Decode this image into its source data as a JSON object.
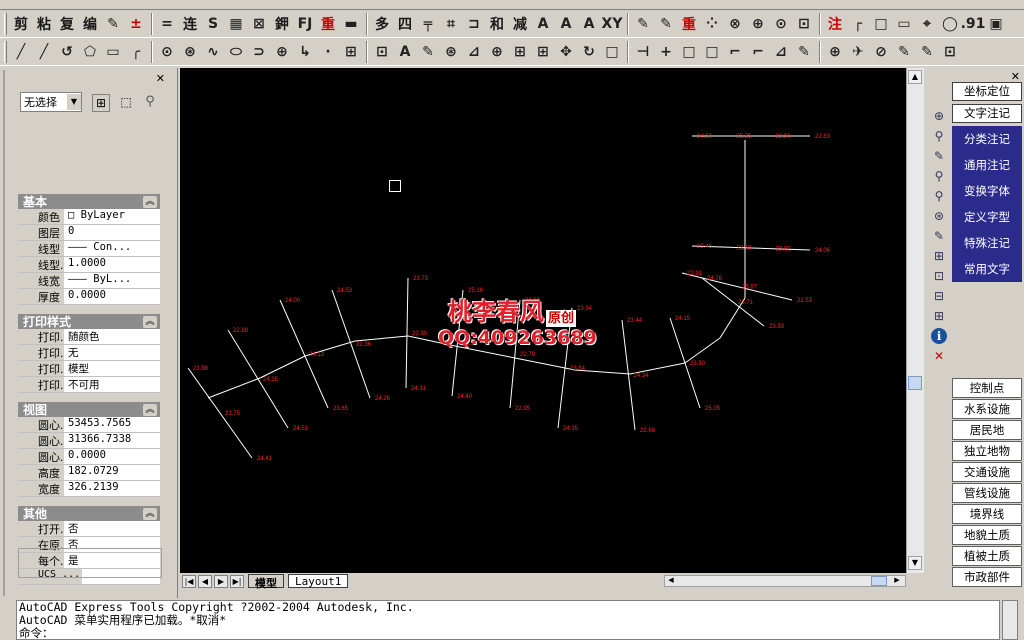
{
  "toolbar1": [
    "剪",
    "粘",
    "复",
    "编",
    "✎",
    "±",
    "=",
    "连",
    "S",
    "▦",
    "⊠",
    "鉀",
    "FJ",
    "重",
    "▬",
    "多",
    "四",
    "╤",
    "⌗",
    "⊐",
    "和",
    "减",
    "A",
    "A",
    "A",
    "XY",
    "✎",
    "✎",
    "重",
    "⁘",
    "⊗",
    "⊕",
    "⊙",
    "⊡",
    "注",
    "┌",
    "□",
    "▭",
    "⌖",
    "◯",
    ".91",
    "▣"
  ],
  "toolbar2": [
    "╱",
    "╱",
    "↺",
    "⬠",
    "▭",
    "╭",
    "⊙",
    "⊛",
    "∿",
    "⬭",
    "⊃",
    "⊕",
    "↳",
    "·",
    "⊞",
    "⊡",
    "A",
    "✎",
    "⊛",
    "⊿",
    "⊕",
    "⊞",
    "⊞",
    "✥",
    "↻",
    "□",
    "⊣",
    "+",
    "□",
    "□",
    "⌐",
    "⌐",
    "⊿",
    "✎",
    "⊕",
    "✈",
    "⊘",
    "✎",
    "✎",
    "⊡"
  ],
  "properties": {
    "select_value": "无选择",
    "sections": [
      {
        "title": "基本",
        "rows": [
          {
            "k": "颜色",
            "v": "□ ByLayer"
          },
          {
            "k": "图层",
            "v": "0"
          },
          {
            "k": "线型",
            "v": "——— Con..."
          },
          {
            "k": "线型...",
            "v": "1.0000"
          },
          {
            "k": "线宽",
            "v": "——— ByL..."
          },
          {
            "k": "厚度",
            "v": "0.0000"
          }
        ]
      },
      {
        "title": "打印样式",
        "rows": [
          {
            "k": "打印...",
            "v": "随颜色"
          },
          {
            "k": "打印...",
            "v": "无"
          },
          {
            "k": "打印...",
            "v": "模型"
          },
          {
            "k": "打印...",
            "v": "不可用"
          }
        ]
      },
      {
        "title": "视图",
        "rows": [
          {
            "k": "圆心...",
            "v": "53453.7565"
          },
          {
            "k": "圆心...",
            "v": "31366.7338"
          },
          {
            "k": "圆心...",
            "v": "0.0000"
          },
          {
            "k": "高度",
            "v": "182.0729"
          },
          {
            "k": "宽度",
            "v": "326.2139"
          }
        ]
      },
      {
        "title": "其他",
        "rows": [
          {
            "k": "打开...",
            "v": "否"
          },
          {
            "k": "在原...",
            "v": "否"
          },
          {
            "k": "每个...",
            "v": "是"
          },
          {
            "k": "UCS ...",
            "v": ""
          }
        ]
      }
    ]
  },
  "watermark": {
    "line1": "桃李春风",
    "badge": "原创",
    "line2": "QQ:409263689"
  },
  "elevation_labels": [
    "23.88",
    "23.75",
    "24.41",
    "22.88",
    "24.35",
    "24.51",
    "24.00",
    "24.13",
    "23.65",
    "24.53",
    "22.36",
    "24.26",
    "23.73",
    "23.90",
    "24.31",
    "25.16",
    "23.59",
    "24.40",
    "24.56",
    "22.79",
    "22.95",
    "23.94",
    "23.84",
    "24.35",
    "23.44",
    "24.34",
    "22.68",
    "24.15",
    "23.50",
    "25.05",
    "24.76",
    "23.71",
    "23.93",
    "22.91",
    "23.87",
    "22.53",
    "23.46",
    "22.58",
    "23.82",
    "24.06",
    "24.50",
    "25.35",
    "22.50",
    "22.83",
    "25.52",
    "23.97",
    "24.27",
    "25.69",
    "24.94",
    "22.81"
  ],
  "tabs": {
    "model": "模型",
    "layout1": "Layout1"
  },
  "right_top_buttons": [
    "坐标定位",
    "文字注记"
  ],
  "right_menu": [
    "分类注记",
    "通用注记",
    "变换字体",
    "定义字型",
    "特殊注记",
    "常用文字"
  ],
  "right_bottom": [
    "控制点",
    "水系设施",
    "居民地",
    "独立地物",
    "交通设施",
    "管线设施",
    "境界线",
    "地貌土质",
    "植被土质",
    "市政部件"
  ],
  "command_lines": [
    "AutoCAD Express Tools Copyright ?2002-2004 Autodesk, Inc.",
    "AutoCAD 菜单实用程序已加载。*取消*",
    "命令："
  ],
  "colors": {
    "canvas_bg": "#000000",
    "line_white": "#ffffff",
    "label_red": "#ff2020",
    "panel_blue": "#2b2b8c",
    "watermark_red": "#e0202a"
  }
}
